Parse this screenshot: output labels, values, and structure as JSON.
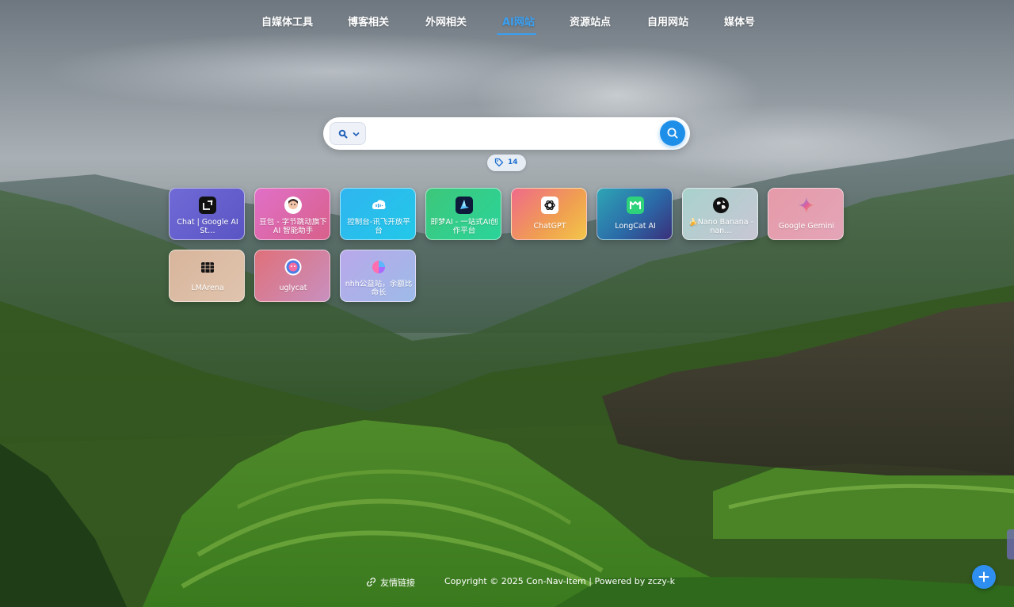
{
  "nav": {
    "items": [
      {
        "label": "自媒体工具"
      },
      {
        "label": "博客相关"
      },
      {
        "label": "外网相关"
      },
      {
        "label": "AI网站"
      },
      {
        "label": "资源站点"
      },
      {
        "label": "自用网站"
      },
      {
        "label": "媒体号"
      }
    ],
    "active": "AI网站"
  },
  "search": {
    "value": "",
    "placeholder": "",
    "engine_icon": "search-icon",
    "submit_icon": "search-icon"
  },
  "tag_filter": {
    "icon": "tag-icon",
    "count": "14"
  },
  "cards": [
    {
      "title": "Chat | Google AI St…",
      "icon": "google-ai-studio-icon"
    },
    {
      "title": "豆包 - 字节跳动旗下 AI 智能助手",
      "icon": "doubao-icon"
    },
    {
      "title": "控制台-讯飞开放平台",
      "icon": "xfyun-icon"
    },
    {
      "title": "即梦AI - 一站式AI创作平台",
      "icon": "jimeng-icon"
    },
    {
      "title": "ChatGPT",
      "icon": "openai-icon"
    },
    {
      "title": "LongCat AI",
      "icon": "longcat-icon"
    },
    {
      "title": "🍌Nano Banana - nan…",
      "icon": "globe-icon"
    },
    {
      "title": "Google Gemini",
      "icon": "gemini-icon"
    },
    {
      "title": "LMArena",
      "icon": "lmarena-icon"
    },
    {
      "title": "uglycat",
      "icon": "uglycat-icon"
    },
    {
      "title": "nhh公益站，余额比命长",
      "icon": "nhh-icon"
    }
  ],
  "footer": {
    "friend_link_label": "友情链接",
    "friend_link_icon": "link-icon",
    "copyright": "Copyright © 2025 Con-Nav-Item | Powered by zczy-k"
  },
  "fab": {
    "icon": "plus-icon"
  },
  "colors": {
    "accent": "#1e8fe8",
    "nav_active": "#3aa0f2",
    "tag_count": "#1e6fd0"
  }
}
